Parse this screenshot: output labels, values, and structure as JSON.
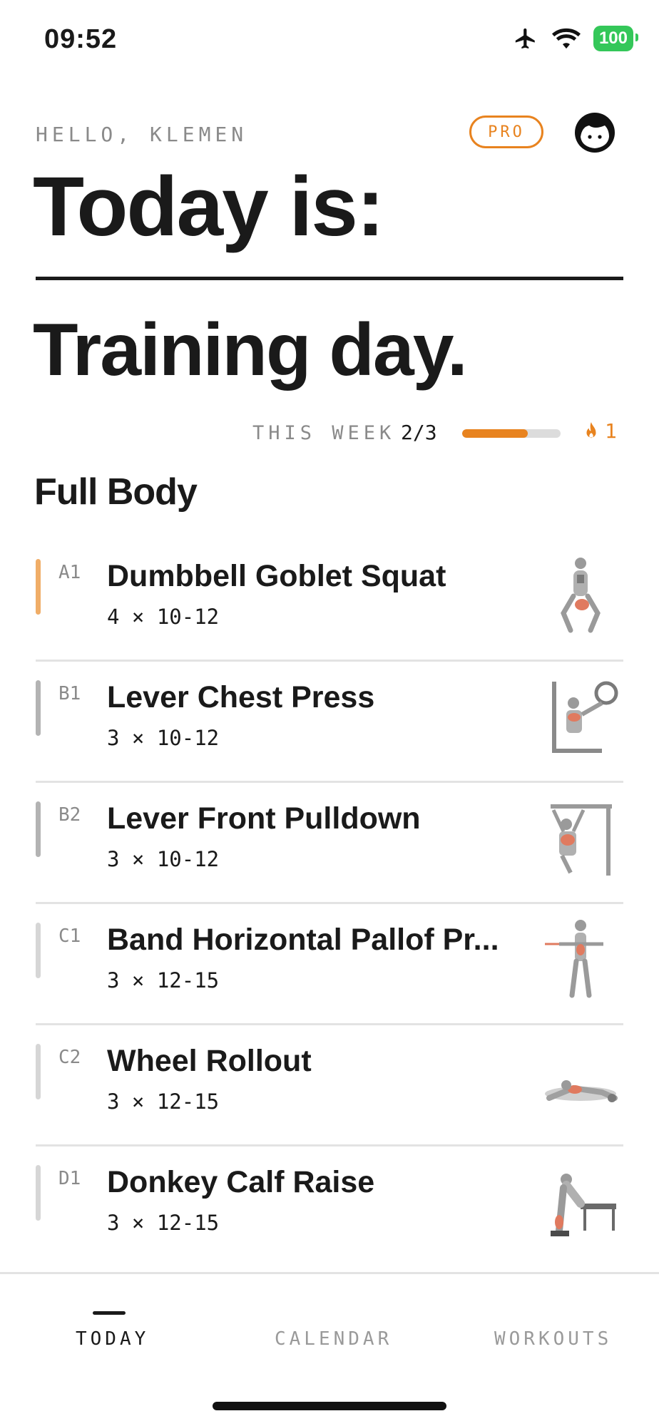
{
  "status_bar": {
    "time": "09:52",
    "battery": "100"
  },
  "header": {
    "greeting": "HELLO, KLEMEN",
    "pro_badge": "PRO",
    "title_line1": "Today is:",
    "title_line2": "Training day."
  },
  "week": {
    "label": "THIS WEEK",
    "count": "2/3",
    "progress_fraction": 0.67,
    "streak": "1",
    "accent_color": "#e8831f"
  },
  "workout": {
    "title": "Full Body",
    "exercises": [
      {
        "code": "A1",
        "name": "Dumbbell Goblet Squat",
        "sets": "4 × 10-12",
        "bar_color": "#f0ad67",
        "illustration": "goblet-squat-figure"
      },
      {
        "code": "B1",
        "name": "Lever Chest Press",
        "sets": "3 × 10-12",
        "bar_color": "#b3b3b3",
        "illustration": "chest-press-figure"
      },
      {
        "code": "B2",
        "name": "Lever Front Pulldown",
        "sets": "3 × 10-12",
        "bar_color": "#b3b3b3",
        "illustration": "pulldown-figure"
      },
      {
        "code": "C1",
        "name": "Band Horizontal Pallof Pr...",
        "sets": "3 × 12-15",
        "bar_color": "#d6d6d6",
        "illustration": "pallof-press-figure"
      },
      {
        "code": "C2",
        "name": "Wheel Rollout",
        "sets": "3 × 12-15",
        "bar_color": "#d6d6d6",
        "illustration": "wheel-rollout-figure"
      },
      {
        "code": "D1",
        "name": "Donkey Calf Raise",
        "sets": "3 × 12-15",
        "bar_color": "#d6d6d6",
        "illustration": "calf-raise-figure"
      }
    ]
  },
  "nav": {
    "tabs": [
      {
        "label": "TODAY",
        "active": true
      },
      {
        "label": "CALENDAR",
        "active": false
      },
      {
        "label": "WORKOUTS",
        "active": false
      }
    ]
  }
}
